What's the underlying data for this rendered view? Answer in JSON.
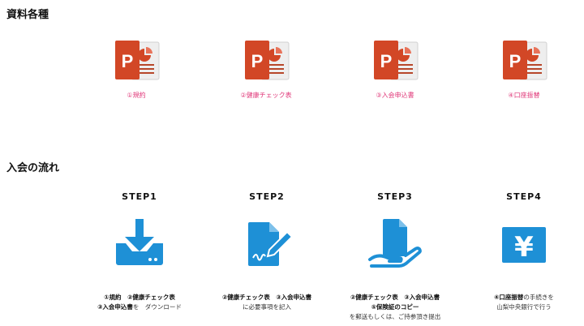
{
  "materials": {
    "title": "資料各種",
    "items": [
      {
        "label": "①規約"
      },
      {
        "label": "②健康チェック表"
      },
      {
        "label": "③入会申込書"
      },
      {
        "label": "④口座振替"
      }
    ]
  },
  "flow": {
    "title": "入会の流れ",
    "steps": [
      {
        "title": "STEP1",
        "line1_bold": "①規約　②健康チェック表",
        "line2_bold": "③入会申込書",
        "line2_text": "を　ダウンロード",
        "line3_bold": "",
        "line3_text": ""
      },
      {
        "title": "STEP2",
        "line1_bold": "②健康チェック表　③入会申込書",
        "line2_bold": "",
        "line2_text": "に必要事項を記入",
        "line3_bold": "",
        "line3_text": ""
      },
      {
        "title": "STEP3",
        "line1_bold": "②健康チェック表　③入会申込書",
        "line2_bold": "⑤保険証のコピー",
        "line2_text": "",
        "line3_bold": "",
        "line3_text": "を郵送もしくは、ご持参頂き提出"
      },
      {
        "title": "STEP4",
        "line1_bold": "④口座振替",
        "line1_text": "の手続きを",
        "line2_bold": "",
        "line2_text": "山梨中央銀行で行う",
        "line3_bold": "",
        "line3_text": ""
      }
    ]
  },
  "colors": {
    "accent_blue": "#1e90d6",
    "link_pink": "#e0397a",
    "ppt_red": "#d24726",
    "ppt_dark": "#b7472a"
  },
  "icons": [
    "powerpoint-file-icon",
    "download-icon",
    "sign-document-icon",
    "hand-document-icon",
    "yen-icon"
  ]
}
